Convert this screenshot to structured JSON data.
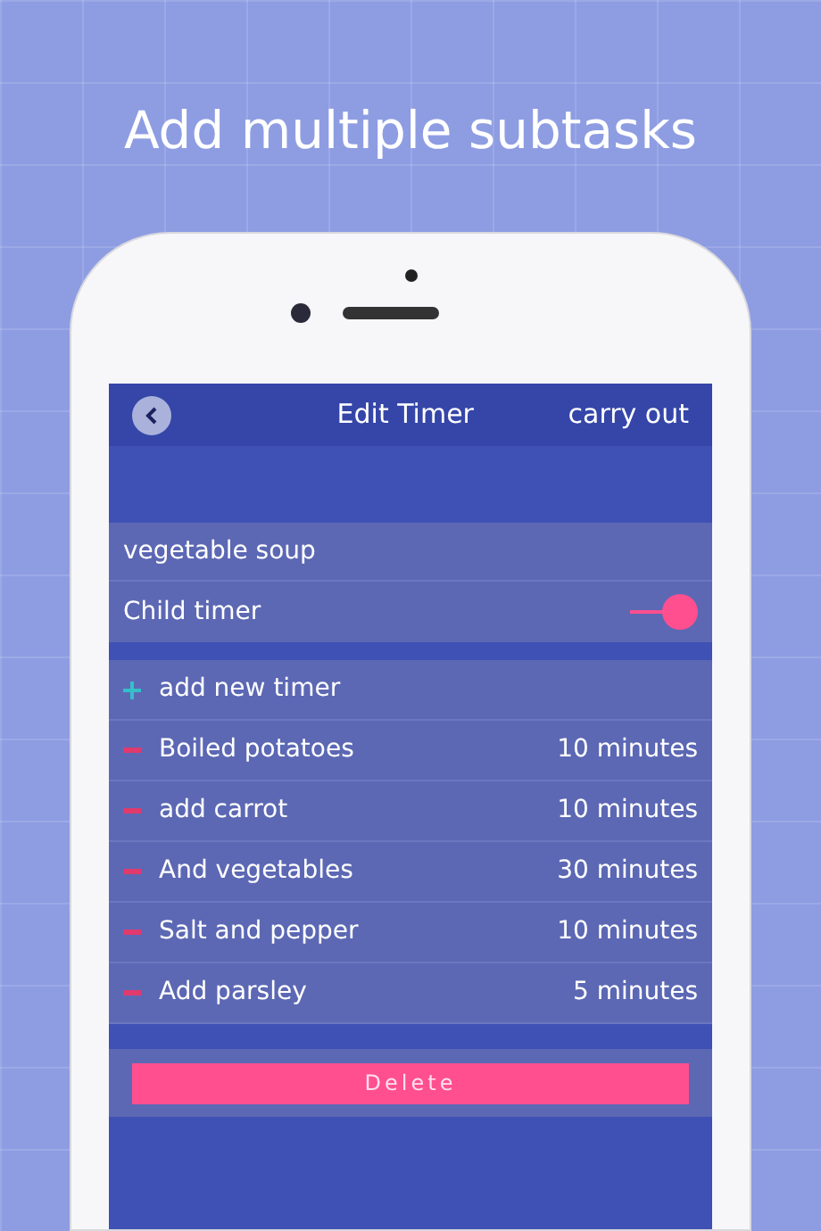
{
  "headline": "Add multiple subtasks",
  "nav": {
    "title": "Edit Timer",
    "action": "carry out"
  },
  "name_field": {
    "value": "vegetable soup"
  },
  "child_timer": {
    "label": "Child timer",
    "on": true
  },
  "timers": [
    {
      "kind": "add",
      "label": "add new timer"
    },
    {
      "kind": "remove",
      "label": "Boiled potatoes",
      "duration": "10 minutes"
    },
    {
      "kind": "remove",
      "label": "add carrot",
      "duration": "10 minutes"
    },
    {
      "kind": "remove",
      "label": "And vegetables",
      "duration": "30 minutes"
    },
    {
      "kind": "remove",
      "label": "Salt and pepper",
      "duration": "10 minutes"
    },
    {
      "kind": "remove",
      "label": "Add parsley",
      "duration": "5 minutes"
    }
  ],
  "delete_button": "Delete"
}
